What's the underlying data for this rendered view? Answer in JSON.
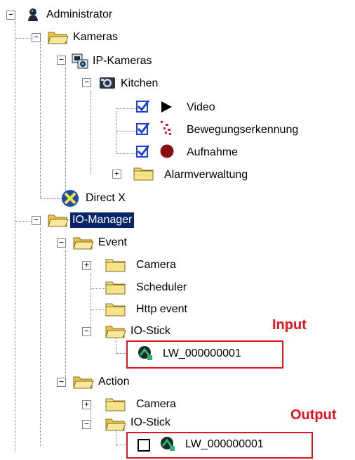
{
  "tree": {
    "root": "Administrator",
    "kameras": "Kameras",
    "ip_kameras": "IP-Kameras",
    "kitchen": "Kitchen",
    "video": "Video",
    "motion": "Bewegungserkennung",
    "record": "Aufnahme",
    "alarm": "Alarmverwaltung",
    "directx": "Direct X",
    "io_manager": "IO-Manager",
    "event": "Event",
    "event_camera": "Camera",
    "scheduler": "Scheduler",
    "http_event": "Http event",
    "event_io_stick": "IO-Stick",
    "input_device": "LW_000000001",
    "action": "Action",
    "action_camera": "Camera",
    "action_io_stick": "IO-Stick",
    "output_device": "LW_000000001"
  },
  "annotations": {
    "input": "Input",
    "output": "Output"
  },
  "colors": {
    "selection": "#0a246a",
    "annotation": "#e0141e",
    "folder": "#f4de7a",
    "check_blue": "#1f3fd0"
  }
}
